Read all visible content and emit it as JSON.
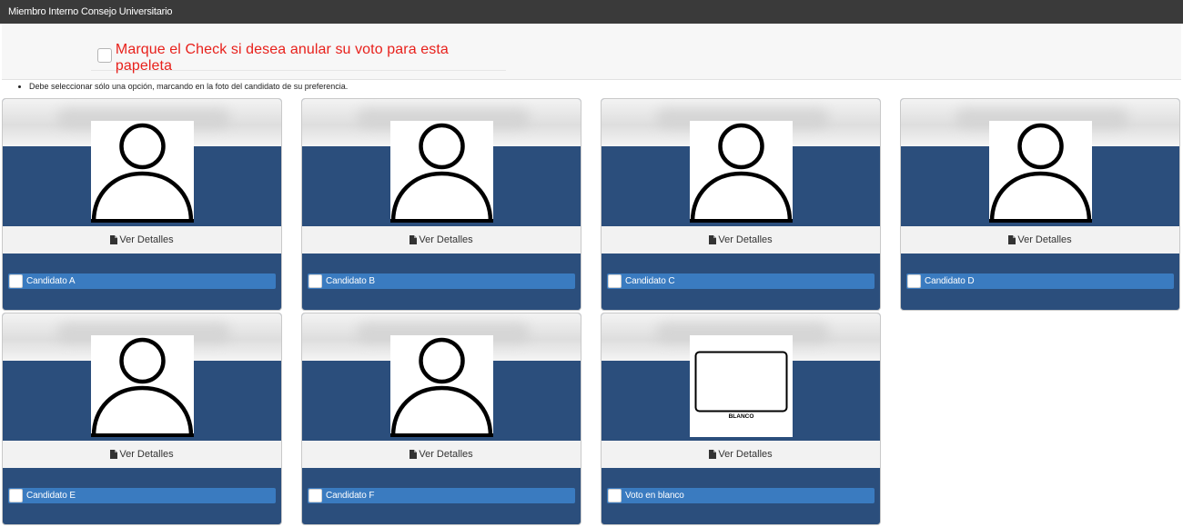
{
  "window": {
    "title": "Miembro Interno Consejo Universitario"
  },
  "annul": {
    "label": "Marque el Check si desea anular su voto para esta papeleta"
  },
  "instructions": [
    "Debe seleccionar sólo una opción, marcando en la foto del candidato de su preferencia."
  ],
  "candidates": [
    {
      "name": "Candidato A",
      "details_label": "Ver Detalles",
      "photo": "person-icon"
    },
    {
      "name": "Candidato B",
      "details_label": "Ver Detalles",
      "photo": "person-icon"
    },
    {
      "name": "Candidato C",
      "details_label": "Ver Detalles",
      "photo": "person-icon"
    },
    {
      "name": "Candidato D",
      "details_label": "Ver Detalles",
      "photo": "person-icon"
    },
    {
      "name": "Candidato E",
      "details_label": "Ver Detalles",
      "photo": "person-icon"
    },
    {
      "name": "Candidato F",
      "details_label": "Ver Detalles",
      "photo": "person-icon"
    },
    {
      "name": "Voto en blanco",
      "details_label": "Ver Detalles",
      "photo": "blank-ballot",
      "photo_text": "BLANCO"
    }
  ],
  "colors": {
    "titlebar": "#3a3a3a",
    "card_band": "#2b4e7c",
    "choose_bar": "#3a7bc0",
    "annul_text": "#e8211c"
  }
}
